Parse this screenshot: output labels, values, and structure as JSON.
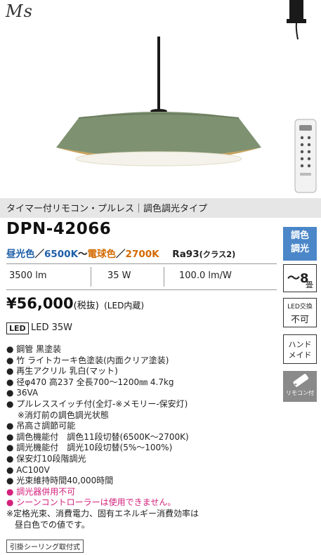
{
  "brand": "Ms",
  "caption": "タイマー付リモコン・プルレス｜調色調光タイプ",
  "model": "DPN-42066",
  "color": {
    "day_label": "昼光色",
    "day_k": "6500K",
    "sep1": "／",
    "tilde": "〜",
    "bulb_label": "電球色",
    "sep2": "／",
    "bulb_k": "2700K",
    "ra": "Ra93",
    "ra_class": "(クラス2)"
  },
  "specs": {
    "lumen": "3500 lm",
    "watt": "35 W",
    "efficiency": "100.0 lm/W"
  },
  "price": {
    "amount": "¥56,000",
    "tax": "(税抜)",
    "note": "(LED内蔵)"
  },
  "led": {
    "badge": "LED",
    "text": "LED 35W"
  },
  "features": [
    "● 鋼管 黒塗装",
    "● 竹 ライトカーキ色塗装(内面クリア塗装)",
    "● 再生アクリル 乳白(マット)",
    "● 径φ470 高237 全長700〜1200㎜ 4.7kg",
    "● 36VA",
    "● プルレススイッチ付(全灯-※メモリー-保安灯)",
    "　 ※消灯前の調色調光状態",
    "● 吊高さ調節可能",
    "● 調色機能付　調色11段切替(6500K〜2700K)",
    "● 調光機能付　調光10段切替(5%〜100%)",
    "● 保安灯10段階調光",
    "● AC100V",
    "● 光束維持時間40,000時間"
  ],
  "warnings": [
    "● 調光器併用不可",
    "● シーンコントローラーは使用できません。"
  ],
  "footnote": [
    "※定格光束、消費電力、固有エネルギー消費効率は",
    "　昼白色での値です。"
  ],
  "footer_box": "引掛シーリング取付式",
  "side": {
    "toning_1": "調色",
    "toning_2": "調光",
    "tatami": "〜8",
    "tatami_unit": "畳",
    "led_exchange_1": "LED交換",
    "led_exchange_2": "不可",
    "handmade_1": "ハンド",
    "handmade_2": "メイド",
    "remote_label": "リモコン付"
  },
  "colors": {
    "shade_green": "#7e9171",
    "bamboo_inner": "#c9a15a",
    "accent_blue": "#1e5fa8",
    "accent_orange": "#d46a00",
    "warning_pink": "#d4217c",
    "badge_blue": "#4a86c8"
  }
}
